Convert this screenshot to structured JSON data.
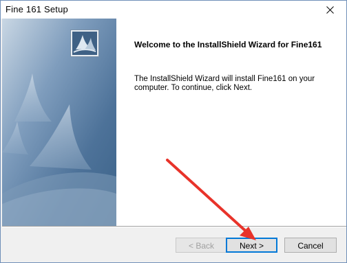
{
  "window": {
    "title": "Fine 161 Setup"
  },
  "content": {
    "heading": "Welcome to the InstallShield Wizard for Fine161",
    "body": "The InstallShield Wizard will install Fine161 on your computer.  To continue, click Next."
  },
  "buttons": {
    "back_label": "< Back",
    "next_label": "Next >",
    "cancel_label": "Cancel"
  },
  "icons": {
    "close": "close-icon",
    "logo": "installshield-logo-icon"
  },
  "colors": {
    "side_panel": "#5a7fa3",
    "annotation_arrow": "#e8332a",
    "focus_border": "#0078d7"
  }
}
